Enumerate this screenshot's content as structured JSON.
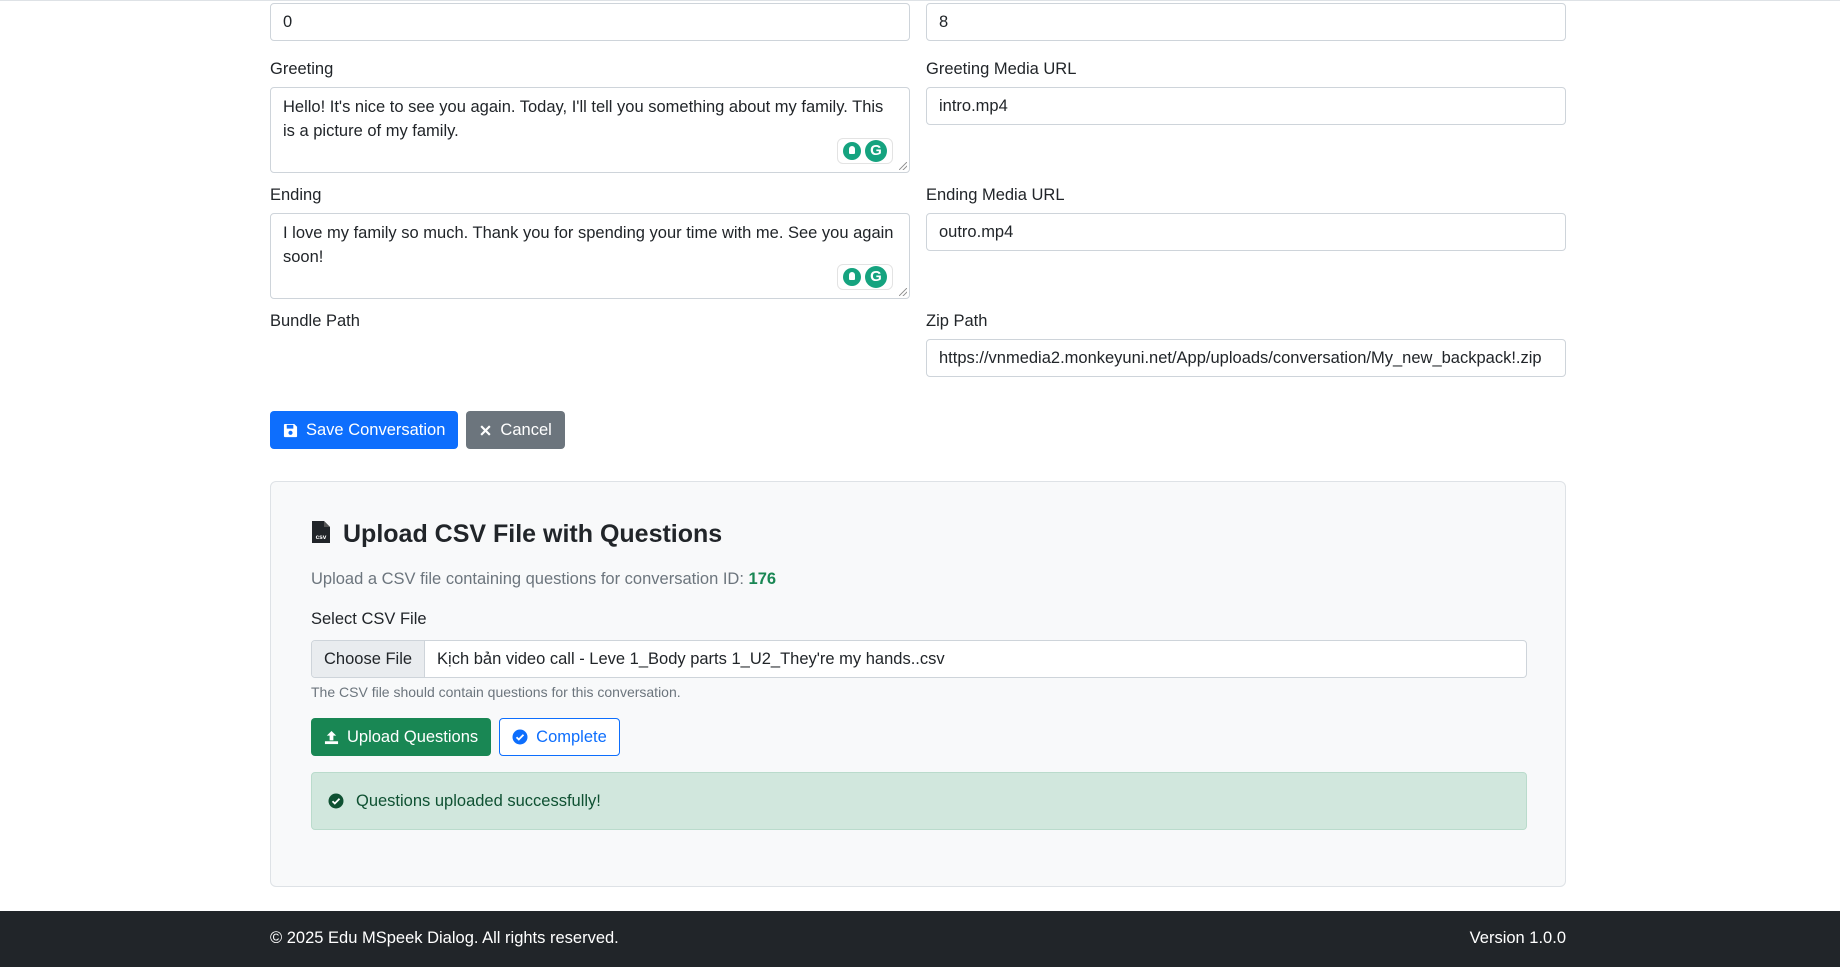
{
  "form": {
    "field_a": {
      "value": "0"
    },
    "field_b": {
      "value": "8"
    },
    "greeting": {
      "label": "Greeting",
      "value": "Hello! It's nice to see you again. Today, I'll tell you something about my family. This is a picture of my family."
    },
    "greeting_media": {
      "label": "Greeting Media URL",
      "value": "intro.mp4"
    },
    "ending": {
      "label": "Ending",
      "value": "I love my family so much. Thank you for spending your time with me. See you again soon!"
    },
    "ending_media": {
      "label": "Ending Media URL",
      "value": "outro.mp4"
    },
    "bundle_path": {
      "label": "Bundle Path"
    },
    "zip_path": {
      "label": "Zip Path",
      "value": "https://vnmedia2.monkeyuni.net/App/uploads/conversation/My_new_backpack!.zip"
    },
    "save_label": "Save Conversation",
    "cancel_label": "Cancel"
  },
  "upload": {
    "title": "Upload CSV File with Questions",
    "desc": "Upload a CSV file containing questions for conversation ID:",
    "conversation_id": "176",
    "file_label": "Select CSV File",
    "choose_label": "Choose File",
    "file_name": "Kịch bản video call - Leve 1_Body parts 1_U2_They're my hands..csv",
    "help": "The CSV file should contain questions for this conversation.",
    "upload_label": "Upload Questions",
    "complete_label": "Complete",
    "alert": "Questions uploaded successfully!",
    "icon_csv": "csv-file-icon"
  },
  "footer": {
    "copyright": "© 2025 Edu MSpeek Dialog. All rights reserved.",
    "version": "Version 1.0.0"
  },
  "colors": {
    "primary": "#0d6efd",
    "secondary": "#6c757d",
    "success": "#198754",
    "alert_bg": "#d1e7dd",
    "footer_bg": "#212529"
  }
}
